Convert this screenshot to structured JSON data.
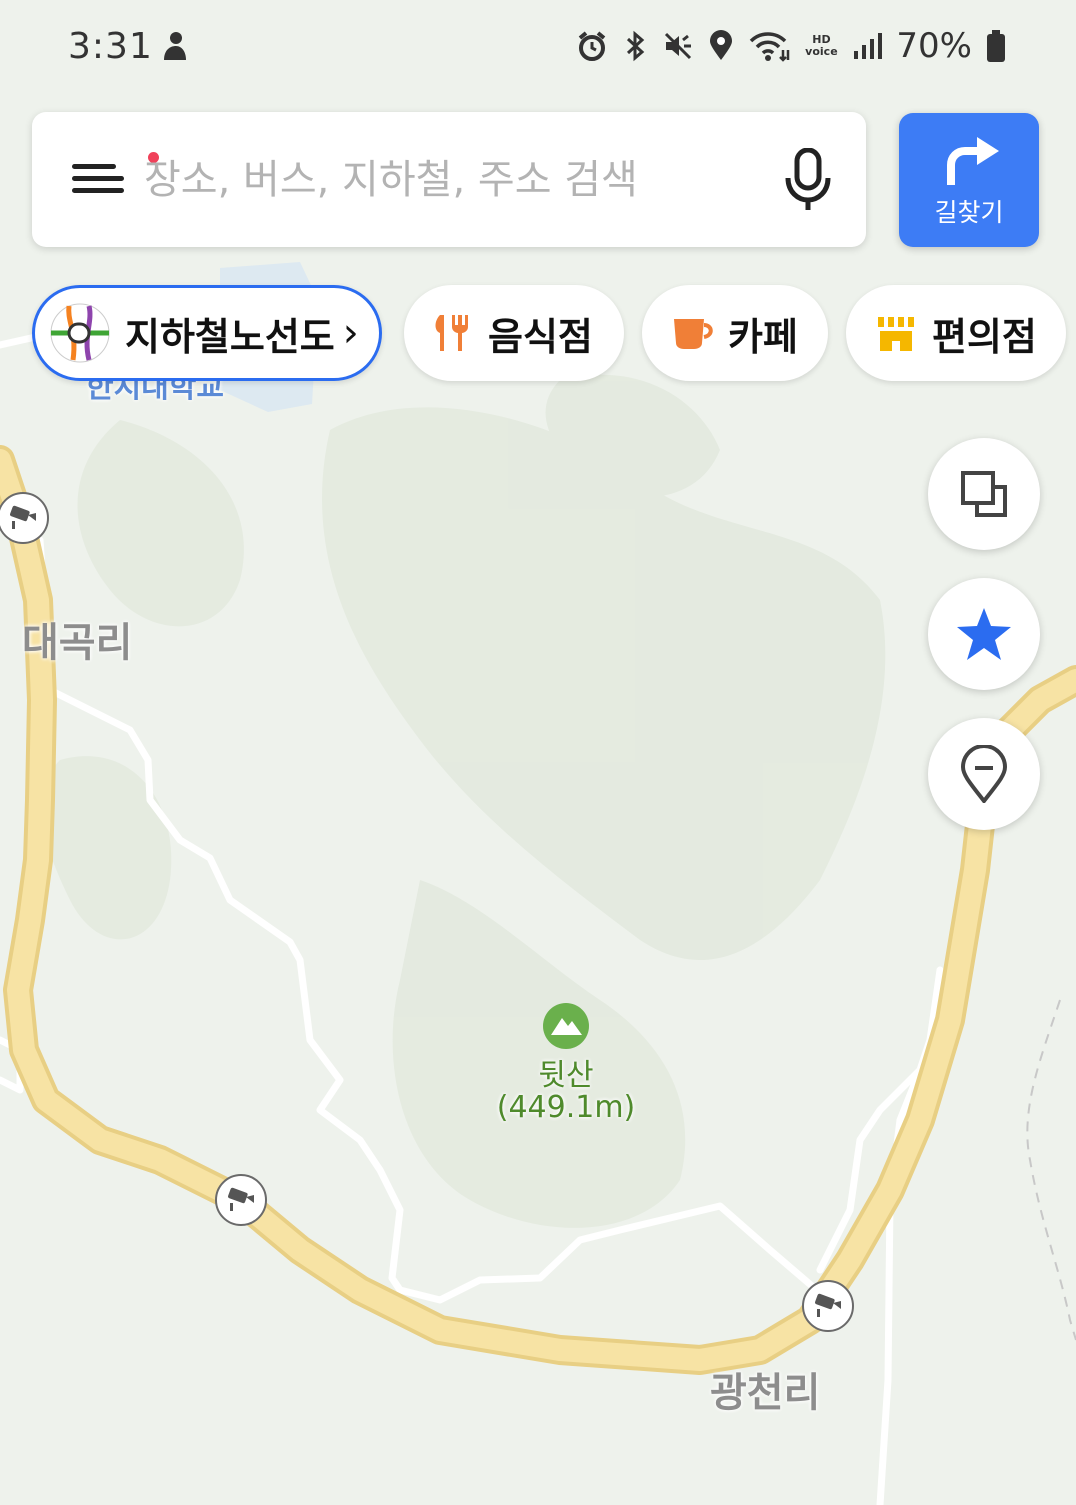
{
  "status_bar": {
    "time": "3:31",
    "network_label": "HD voice",
    "battery": "70%"
  },
  "search": {
    "placeholder": "장소, 버스, 지하철, 주소 검색",
    "value": "",
    "route_label": "길찾기",
    "accent_color": "#3d7cf5"
  },
  "chips": [
    {
      "label": "지하철노선도",
      "icon": "subway-map-icon",
      "arrow": "›"
    },
    {
      "label": "음식점",
      "icon": "fork-knife-icon"
    },
    {
      "label": "카페",
      "icon": "coffee-cup-icon"
    },
    {
      "label": "편의점",
      "icon": "store-icon"
    }
  ],
  "map_labels": {
    "place_1": "대곡리",
    "place_2": "광천리",
    "university": "한지대학교",
    "peak_name": "뒷산",
    "peak_height": "(449.1m)"
  },
  "fabs": [
    "layers-icon",
    "favorite-star-icon",
    "location-pin-icon"
  ],
  "colors": {
    "road_main": "#f7e3a4",
    "road_border": "#e8cf84",
    "road_minor": "#ffffff",
    "map_bg": "#eef2ec",
    "peak_green": "#6ab04c"
  }
}
